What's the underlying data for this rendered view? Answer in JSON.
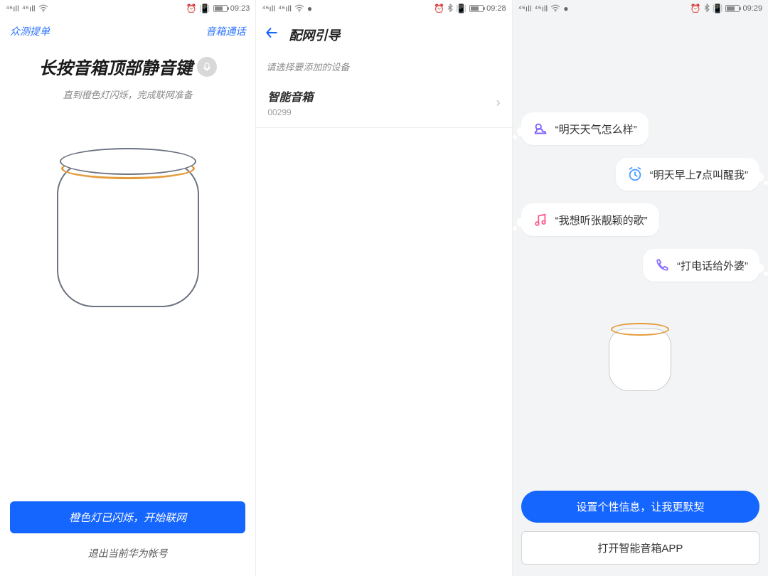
{
  "screen1": {
    "status": {
      "time": "09:23"
    },
    "links": {
      "left": "众测提单",
      "right": "音箱通话"
    },
    "title": "长按音箱顶部静音键",
    "subtitle": "直到橙色灯闪烁，完成联网准备",
    "primary_button": "橙色灯已闪烁，开始联网",
    "exit_link": "退出当前华为帐号"
  },
  "screen2": {
    "status": {
      "time": "09:28"
    },
    "nav_title": "配网引导",
    "section_caption": "请选择要添加的设备",
    "device": {
      "name": "智能音箱",
      "code": "00299"
    }
  },
  "screen3": {
    "status": {
      "time": "09:29"
    },
    "bubbles": [
      {
        "text": "“明天天气怎么样”",
        "icon": "weather",
        "align": "left"
      },
      {
        "text_pre": "“明天早上",
        "digit": "7",
        "text_post": "点叫醒我”",
        "icon": "alarm",
        "align": "right"
      },
      {
        "text": "“我想听张靓颖的歌”",
        "icon": "music",
        "align": "left"
      },
      {
        "text": "“打电话给外婆”",
        "icon": "phone",
        "align": "right"
      }
    ],
    "primary_button": "设置个性信息，让我更默契",
    "secondary_button": "打开智能音箱APP"
  },
  "colors": {
    "accent_blue": "#1565ff",
    "speaker_ring": "#e49b3a",
    "purple": "#7c5cff",
    "pink": "#ff5a8a",
    "teal": "#4a9eff"
  }
}
